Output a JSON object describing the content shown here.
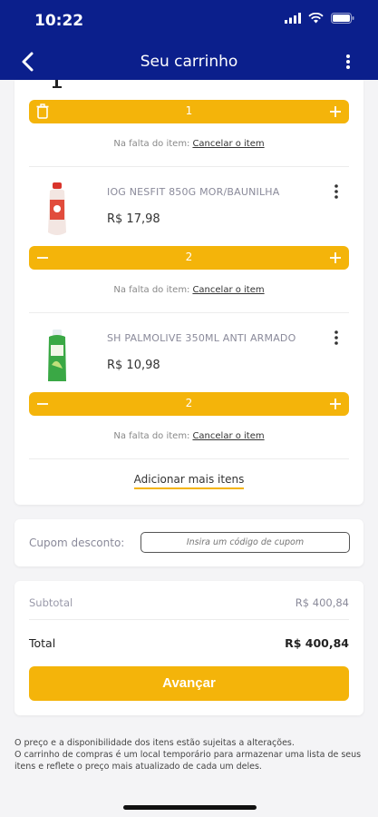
{
  "status_bar": {
    "time": "10:22"
  },
  "header": {
    "title": "Seu carrinho"
  },
  "items": [
    {
      "name": "",
      "price": "",
      "quantity": "1",
      "missing_label": "Na falta do item:",
      "cancel_label": "Cancelar o item"
    },
    {
      "name": "IOG NESFIT 850G MOR/BAUNILHA",
      "price": "R$ 17,98",
      "quantity": "2",
      "missing_label": "Na falta do item:",
      "cancel_label": "Cancelar o item"
    },
    {
      "name": "SH PALMOLIVE 350ML ANTI ARMADO",
      "price": "R$ 10,98",
      "quantity": "2",
      "missing_label": "Na falta do item:",
      "cancel_label": "Cancelar o item"
    }
  ],
  "add_more_label": "Adicionar mais itens",
  "coupon": {
    "label": "Cupom desconto:",
    "placeholder": "Insira um código de cupom"
  },
  "totals": {
    "subtotal_label": "Subtotal",
    "subtotal_value": "R$ 400,84",
    "total_label": "Total",
    "total_value": "R$ 400,84"
  },
  "advance_label": "Avançar",
  "disclaimer": [
    "O preço e a disponibilidade dos itens estão sujeitas a alterações.",
    "O carrinho de compras é um local temporário para armazenar uma lista de seus itens e reflete o preço mais atualizado de cada um deles."
  ],
  "colors": {
    "header_bg": "#0b1f8c",
    "accent": "#f4b40a"
  },
  "icons": [
    "back-arrow-icon",
    "more-vertical-icon",
    "trash-icon",
    "plus-icon",
    "minus-icon",
    "wifi-icon",
    "battery-icon",
    "signal-icon"
  ]
}
